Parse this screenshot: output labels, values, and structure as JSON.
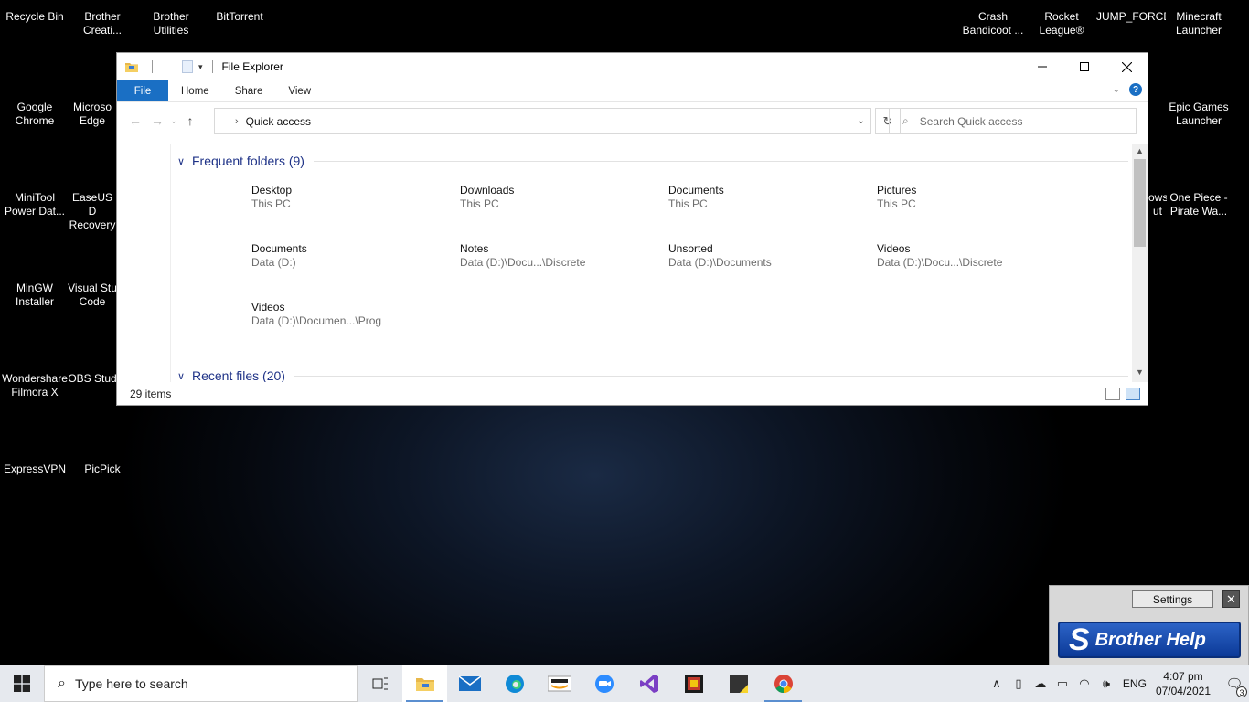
{
  "desktop": {
    "icons": {
      "recycle_bin": "Recycle Bin",
      "brother_creative": "Brother\nCreati...",
      "brother_utilities": "Brother\nUtilities",
      "bittorrent": "BitTorrent",
      "crash_bandicoot": "Crash\nBandicoot ...",
      "rocket_league": "Rocket\nLeague®",
      "jump_force": "JUMP_FORCE",
      "minecraft": "Minecraft\nLauncher",
      "google_chrome": "Google\nChrome",
      "microsoft_edge": "Microso\nEdge",
      "epic_games": "Epic Games\nLauncher",
      "minitool": "MiniTool\nPower Dat...",
      "easeus": "EaseUS D\nRecovery",
      "windows_partial": "ows\nut",
      "one_piece": "One Piece -\nPirate Wa...",
      "mingw": "MinGW\nInstaller",
      "vscode": "Visual Stu\nCode",
      "wondershare": "Wondershare\nFilmora X",
      "obs": "OBS Stud",
      "expressvpn": "ExpressVPN",
      "picpick": "PicPick"
    }
  },
  "explorer": {
    "title": "File Explorer",
    "ribbon_tabs": {
      "file": "File",
      "home": "Home",
      "share": "Share",
      "view": "View"
    },
    "address": "Quick access",
    "search_placeholder": "Search Quick access",
    "frequent_header": "Frequent folders (9)",
    "recent_header": "Recent files (20)",
    "frequent": [
      {
        "name": "Desktop",
        "loc": "This PC"
      },
      {
        "name": "Downloads",
        "loc": "This PC"
      },
      {
        "name": "Documents",
        "loc": "This PC"
      },
      {
        "name": "Pictures",
        "loc": "This PC"
      },
      {
        "name": "Documents",
        "loc": "Data (D:)"
      },
      {
        "name": "Notes",
        "loc": "Data (D:)\\Docu...\\Discrete"
      },
      {
        "name": "Unsorted",
        "loc": "Data (D:)\\Documents"
      },
      {
        "name": "Videos",
        "loc": "Data (D:)\\Docu...\\Discrete"
      },
      {
        "name": "Videos",
        "loc": "Data (D:)\\Documen...\\Prog"
      }
    ],
    "status_count": "29 items"
  },
  "brother_widget": {
    "settings_label": "Settings",
    "close_glyph": "✕",
    "banner_logo": "S",
    "banner_text": "Brother Help"
  },
  "taskbar": {
    "search_placeholder": "Type here to search",
    "language": "ENG",
    "time": "4:07 pm",
    "date": "07/04/2021",
    "notification_count": "3"
  }
}
